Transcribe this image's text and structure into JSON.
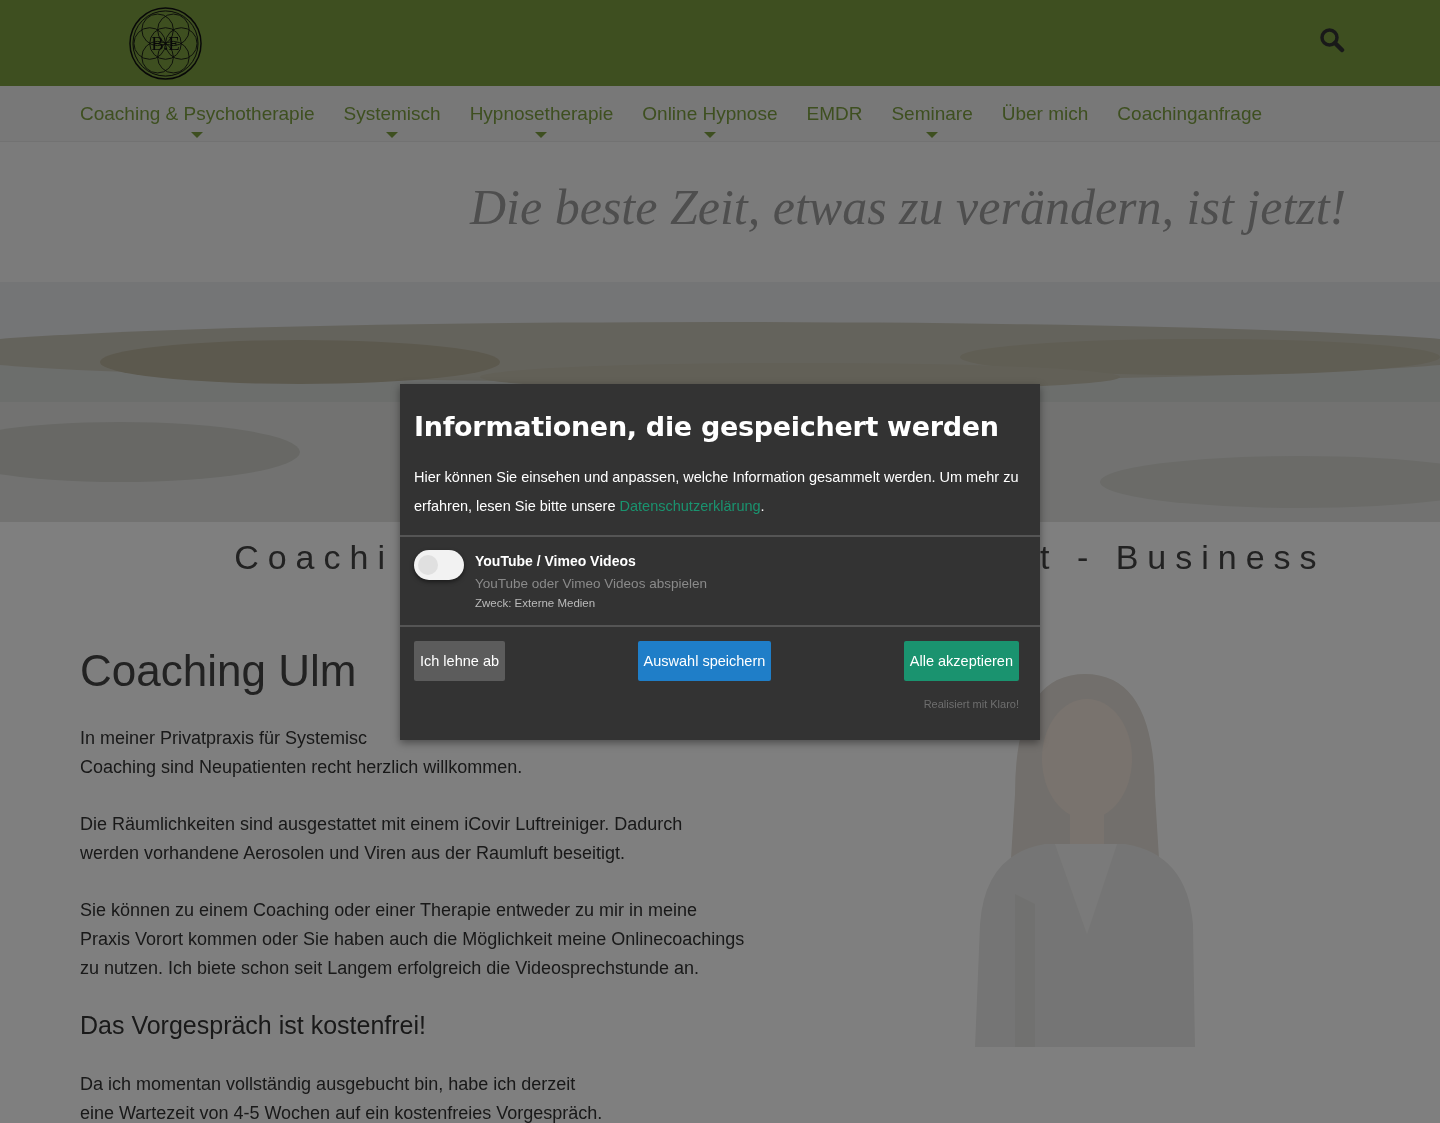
{
  "header": {
    "logo": {
      "text": "B.E"
    }
  },
  "nav": [
    {
      "label": "Coaching & Psychotherapie",
      "has_submenu": true
    },
    {
      "label": "Systemisch",
      "has_submenu": true
    },
    {
      "label": "Hypnosetherapie",
      "has_submenu": true
    },
    {
      "label": "Online Hypnose",
      "has_submenu": true
    },
    {
      "label": "EMDR",
      "has_submenu": false
    },
    {
      "label": "Seminare",
      "has_submenu": true
    },
    {
      "label": "Über mich",
      "has_submenu": false
    },
    {
      "label": "Coachinganfrage",
      "has_submenu": false
    }
  ],
  "hero": {
    "kind": "picture",
    "quote": "Die beste Zeit, etwas zu verändern, ist jetzt!"
  },
  "subtitle": {
    "left": "Coachi",
    "right": "t - Business"
  },
  "main": {
    "heading": "Coaching Ulm",
    "paragraphs": [
      {
        "lines": [
          "In meiner Privatpraxis für Systemisc",
          "Coaching sind Neupatienten recht herzlich willkommen."
        ]
      },
      {
        "lines": [
          "Die Räumlichkeiten sind ausgestattet mit einem iCovir Luftreiniger. Dadurch",
          "werden vorhandene Aerosolen und Viren aus der Raumluft beseitigt."
        ]
      },
      {
        "lines": [
          "Sie können zu einem Coaching oder einer Therapie entweder zu mir in meine",
          "Praxis Vorort kommen oder Sie haben auch die Möglichkeit meine Onlinecoachings",
          "zu nutzen. Ich biete schon seit Langem erfolgreich die Videosprechstunde an."
        ]
      }
    ],
    "subheading": "Das Vorgespräch ist kostenfrei!",
    "closing": {
      "lines": [
        "Da ich momentan vollständig ausgebucht bin, habe ich derzeit",
        "eine Wartezeit von 4-5 Wochen auf ein kostenfreies Vorgespräch."
      ]
    }
  },
  "consent": {
    "title": "Informationen, die gespeichert werden",
    "intro": "Hier können Sie einsehen und anpassen, welche Information gesammelt werden. Um mehr zu erfahren, lesen Sie bitte unsere",
    "privacy_link": "Datenschutzerklärung",
    "intro_end": ".",
    "services": [
      {
        "name": "YouTube / Vimeo Videos",
        "description": "YouTube oder Vimeo Videos abspielen",
        "purpose": "Zweck: Externe Medien",
        "checked": false
      }
    ],
    "buttons": [
      {
        "label": "Ich lehne ab",
        "kind": "decline"
      },
      {
        "label": "Auswahl speichern",
        "kind": "save"
      },
      {
        "label": "Alle akzeptieren",
        "kind": "accept"
      }
    ],
    "footer_link": "Realisiert mit Klaro!"
  }
}
